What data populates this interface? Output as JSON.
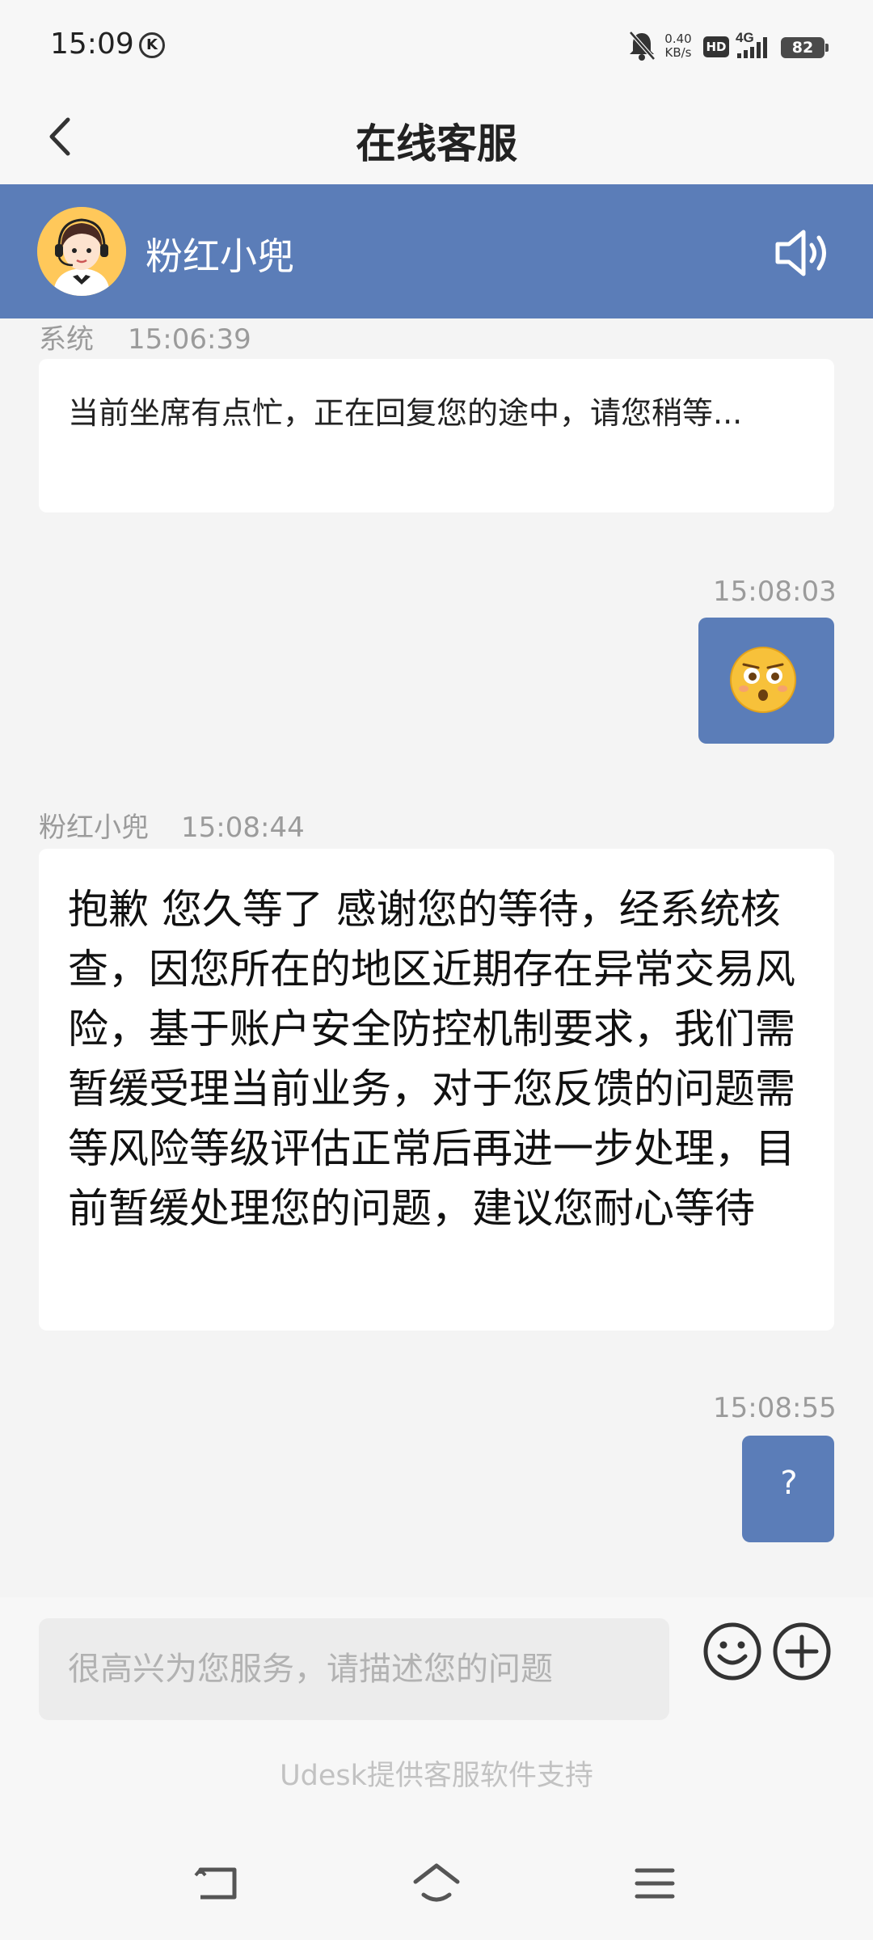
{
  "status_bar": {
    "time": "15:09",
    "k_badge": "K",
    "net_speed_value": "0.40",
    "net_speed_unit": "KB/s",
    "hd": "HD",
    "network": "4G",
    "battery": "82"
  },
  "nav": {
    "title": "在线客服"
  },
  "agent": {
    "name": "粉红小兜"
  },
  "messages": [
    {
      "sender": "系统",
      "time": "15:06:39",
      "text": "当前坐席有点忙，正在回复您的途中，请您稍等..."
    },
    {
      "sender": "",
      "time": "15:08:03",
      "content": "emoji"
    },
    {
      "sender": "粉红小兜",
      "time": "15:08:44",
      "text": "抱歉 您久等了 感谢您的等待，经系统核查，因您所在的地区近期存在异常交易风险，基于账户安全防控机制要求，我们需暂缓受理当前业务，对于您反馈的问题需等风险等级评估正常后再进一步处理，目前暂缓处理您的问题，建议您耐心等待"
    },
    {
      "sender": "",
      "time": "15:08:55",
      "text": "?"
    }
  ],
  "input": {
    "placeholder": "很高兴为您服务，请描述您的问题"
  },
  "footer": {
    "powered_by": "Udesk提供客服软件支持"
  },
  "colors": {
    "accent": "#5b7db8",
    "background": "#f4f4f4"
  }
}
